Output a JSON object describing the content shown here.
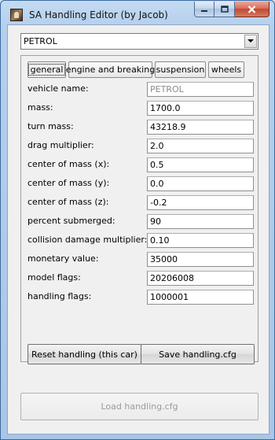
{
  "window": {
    "title": "SA Handling Editor (by Jacob)"
  },
  "vehicle_select": {
    "selected": "PETROL"
  },
  "tabs": [
    {
      "label": "general",
      "active": true
    },
    {
      "label": "engine and breaking",
      "active": false
    },
    {
      "label": "suspension",
      "active": false
    },
    {
      "label": "wheels",
      "active": false
    }
  ],
  "fields": [
    {
      "label": "vehicle name:",
      "value": "PETROL",
      "readonly": true
    },
    {
      "label": "mass:",
      "value": "1700.0"
    },
    {
      "label": "turn mass:",
      "value": "43218.9"
    },
    {
      "label": "drag multiplier:",
      "value": "2.0"
    },
    {
      "label": "center of mass (x):",
      "value": "0.5"
    },
    {
      "label": "center of mass (y):",
      "value": "0.0"
    },
    {
      "label": "center of mass (z):",
      "value": "-0.2"
    },
    {
      "label": "percent submerged:",
      "value": "90"
    },
    {
      "label": "collision damage multiplier:",
      "value": "0.10"
    },
    {
      "label": "monetary value:",
      "value": "35000"
    },
    {
      "label": "model flags:",
      "value": "20206008"
    },
    {
      "label": "handling flags:",
      "value": "1000001"
    }
  ],
  "buttons": {
    "reset": "Reset handling (this car)",
    "save": "Save handling.cfg",
    "load": "Load handling.cfg"
  },
  "icons": {
    "app": "app-icon",
    "minimize": "minimize-icon",
    "maximize": "maximize-icon",
    "close": "close-icon",
    "dropdown": "chevron-down-icon"
  }
}
